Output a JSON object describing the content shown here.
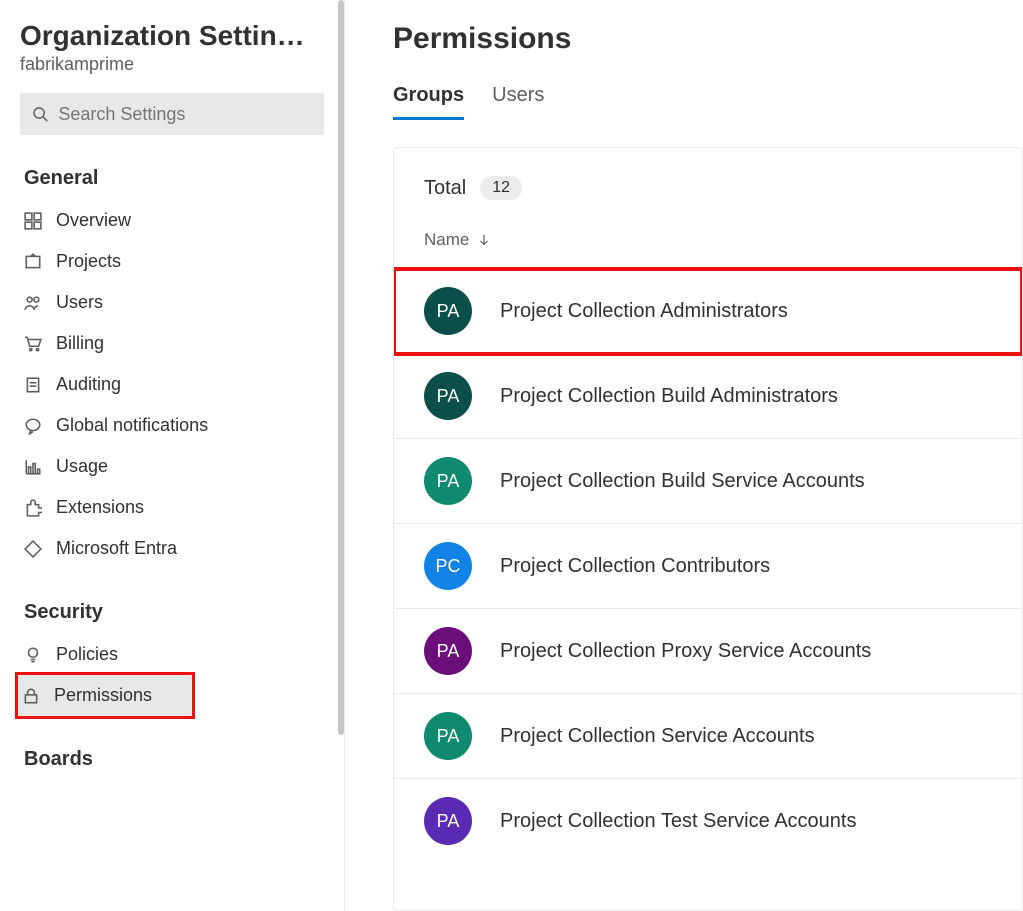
{
  "sidebar": {
    "title": "Organization Settin…",
    "subtitle": "fabrikamprime",
    "search_placeholder": "Search Settings",
    "sections": {
      "general": {
        "label": "General",
        "items": [
          "Overview",
          "Projects",
          "Users",
          "Billing",
          "Auditing",
          "Global notifications",
          "Usage",
          "Extensions",
          "Microsoft Entra"
        ]
      },
      "security": {
        "label": "Security",
        "items": [
          "Policies",
          "Permissions"
        ]
      },
      "boards": {
        "label": "Boards"
      }
    }
  },
  "main": {
    "title": "Permissions",
    "tabs": {
      "groups": "Groups",
      "users": "Users"
    },
    "total_label": "Total",
    "total_count": "12",
    "column_header": "Name",
    "groups": [
      {
        "initials": "PA",
        "name": "Project Collection Administrators",
        "color": "#0b4f4a",
        "highlight": true
      },
      {
        "initials": "PA",
        "name": "Project Collection Build Administrators",
        "color": "#0b4f4a"
      },
      {
        "initials": "PA",
        "name": "Project Collection Build Service Accounts",
        "color": "#0e8a6e"
      },
      {
        "initials": "PC",
        "name": "Project Collection Contributors",
        "color": "#1183e6"
      },
      {
        "initials": "PA",
        "name": "Project Collection Proxy Service Accounts",
        "color": "#6b0e7a"
      },
      {
        "initials": "PA",
        "name": "Project Collection Service Accounts",
        "color": "#0e8a6e"
      },
      {
        "initials": "PA",
        "name": "Project Collection Test Service Accounts",
        "color": "#5b2ab5"
      }
    ]
  }
}
